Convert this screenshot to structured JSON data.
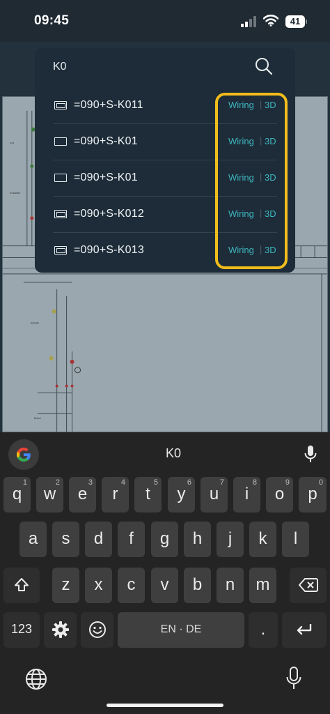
{
  "status_bar": {
    "time": "09:45",
    "battery_level": "41",
    "icons": [
      "signal-icon",
      "wifi-icon",
      "battery-icon"
    ]
  },
  "search": {
    "query": "K0",
    "icon": "search-icon"
  },
  "results": [
    {
      "label": "=090+S-K011",
      "icon": "double-frame-icon",
      "wiring": "Wiring",
      "separator": "|",
      "view3d": "3D"
    },
    {
      "label": "=090+S-K01",
      "icon": "frame-icon",
      "wiring": "Wiring",
      "separator": "|",
      "view3d": "3D"
    },
    {
      "label": "=090+S-K01",
      "icon": "frame-icon",
      "wiring": "Wiring",
      "separator": "|",
      "view3d": "3D"
    },
    {
      "label": "=090+S-K012",
      "icon": "double-frame-icon",
      "wiring": "Wiring",
      "separator": "|",
      "view3d": "3D"
    },
    {
      "label": "=090+S-K013",
      "icon": "double-frame-icon",
      "wiring": "Wiring",
      "separator": "|",
      "view3d": "3D"
    }
  ],
  "keyboard": {
    "suggestion": "K0",
    "row1": [
      {
        "key": "q",
        "hint": "1"
      },
      {
        "key": "w",
        "hint": "2"
      },
      {
        "key": "e",
        "hint": "3"
      },
      {
        "key": "r",
        "hint": "4"
      },
      {
        "key": "t",
        "hint": "5"
      },
      {
        "key": "y",
        "hint": "6"
      },
      {
        "key": "u",
        "hint": "7"
      },
      {
        "key": "i",
        "hint": "8"
      },
      {
        "key": "o",
        "hint": "9"
      },
      {
        "key": "p",
        "hint": "0"
      }
    ],
    "row2": [
      "a",
      "s",
      "d",
      "f",
      "g",
      "h",
      "j",
      "k",
      "l"
    ],
    "row3": [
      "z",
      "x",
      "c",
      "v",
      "b",
      "n",
      "m"
    ],
    "numbers_label": "123",
    "space_label": "EN · DE",
    "period_label": "."
  },
  "colors": {
    "accent": "#3fb5bf",
    "highlight": "#f2bd1c",
    "panel": "#1d2c38"
  }
}
